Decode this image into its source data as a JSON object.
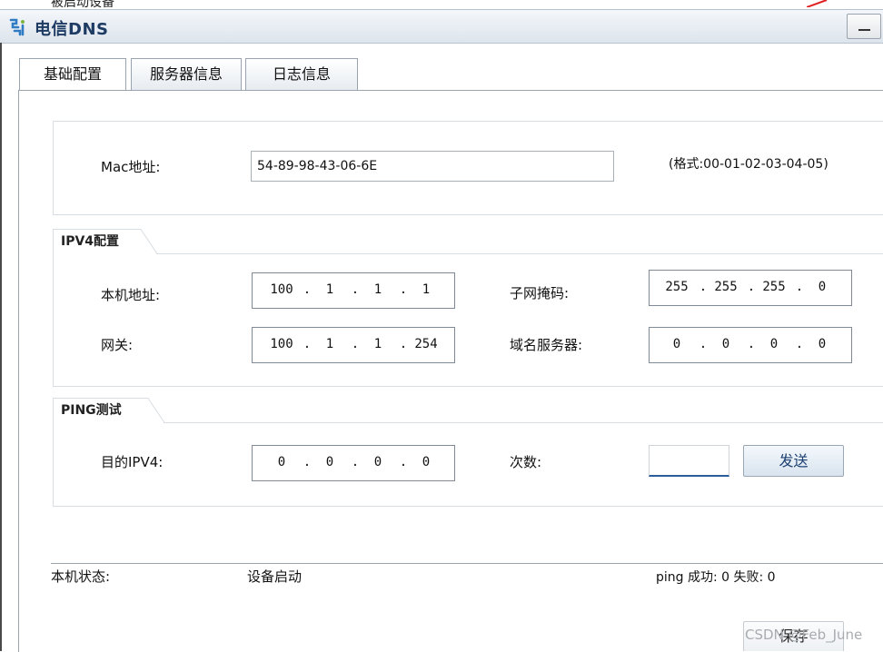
{
  "window": {
    "title": "电信DNS",
    "cut_text": "被启动设备"
  },
  "tabs": [
    {
      "label": "基础配置",
      "active": true
    },
    {
      "label": "服务器信息",
      "active": false
    },
    {
      "label": "日志信息",
      "active": false
    }
  ],
  "mac": {
    "label": "Mac地址:",
    "value": "54-89-98-43-06-6E",
    "hint": "(格式:00-01-02-03-04-05)"
  },
  "ipv4": {
    "legend": "IPV4配置",
    "local_address": {
      "label": "本机地址:",
      "octets": [
        "100",
        "1",
        "1",
        "1"
      ]
    },
    "subnet_mask": {
      "label": "子网掩码:",
      "octets": [
        "255",
        "255",
        "255",
        "0"
      ]
    },
    "gateway": {
      "label": "网关:",
      "octets": [
        "100",
        "1",
        "1",
        "254"
      ]
    },
    "dns_server": {
      "label": "域名服务器:",
      "octets": [
        "0",
        "0",
        "0",
        "0"
      ]
    }
  },
  "ping": {
    "legend": "PING测试",
    "target": {
      "label": "目的IPV4:",
      "octets": [
        "0",
        "0",
        "0",
        "0"
      ]
    },
    "count": {
      "label": "次数:",
      "value": ""
    },
    "send_label": "发送"
  },
  "status": {
    "label": "本机状态:",
    "value": "设备启动",
    "ping_result": "ping 成功: 0 失败: 0"
  },
  "save_label": "保存",
  "watermark": "CSDN @Feb_June",
  "colors": {
    "title_text": "#1e3b63",
    "button_text": "#1c3f72",
    "accent_underline": "#2a5d98",
    "annotation_red": "#e02020"
  }
}
